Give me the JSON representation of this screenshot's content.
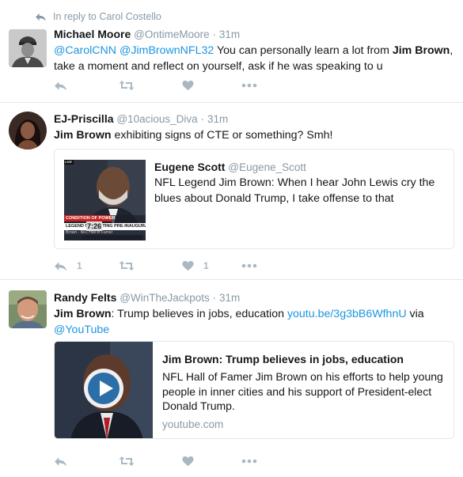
{
  "reply_context": {
    "text": "In reply to Carol Costello"
  },
  "tweets": [
    {
      "name": "Michael Moore",
      "handle": "@OntimeMoore",
      "dot": "·",
      "time": "31m",
      "mention1": "@CarolCNN",
      "mention2": "@JimBrownNFL32",
      "text_a": " You can personally learn a lot from ",
      "bold": "Jim Brown",
      "text_b": ", take a moment and reflect on yourself, ask if he was speaking to u"
    },
    {
      "name": "EJ-Priscilla",
      "handle": "@10acious_Diva",
      "dot": "·",
      "time": "31m",
      "bold": "Jim Brown",
      "text_a": " exhibiting signs of CTE or something? Smh!",
      "quote": {
        "name": "Eugene Scott",
        "handle": "@Eugene_Scott",
        "text": "NFL Legend Jim Brown: When I hear John Lewis cry the blues about Donald Trump, I take offense to that",
        "thumb_banner_a": "CONDITION OF POWER",
        "thumb_banner_b": "LEGEND    NO-HOSTING PRE-INAUGURAT",
        "thumb_clock": "7:26",
        "thumb_caption": "Brown · NFL Hall of Famer",
        "thumb_tag": "LIVE"
      },
      "retweet_count": "",
      "reply_count": "1",
      "like_count": "1"
    },
    {
      "name": "Randy Felts",
      "handle": "@WinTheJackpots",
      "dot": "·",
      "time": "31m",
      "bold": "Jim Brown",
      "text_a": ": Trump believes in jobs, education ",
      "link": "youtu.be/3g3bB6WfhnU",
      "text_b": " via ",
      "mention1": "@YouTube",
      "card": {
        "title": "Jim Brown: Trump believes in jobs, education",
        "description": "NFL Hall of Famer Jim Brown on his efforts to help young people in inner cities and his support of President-elect Donald Trump.",
        "domain": "youtube.com"
      }
    }
  ],
  "icons": {
    "reply": "reply-icon",
    "retweet": "retweet-icon",
    "like": "heart-icon",
    "more": "more-dots-icon",
    "play": "play-icon"
  },
  "colors": {
    "link": "#1b95e0",
    "muted": "#8899a6",
    "action": "#aab8c2",
    "border": "#e1e8ed"
  }
}
